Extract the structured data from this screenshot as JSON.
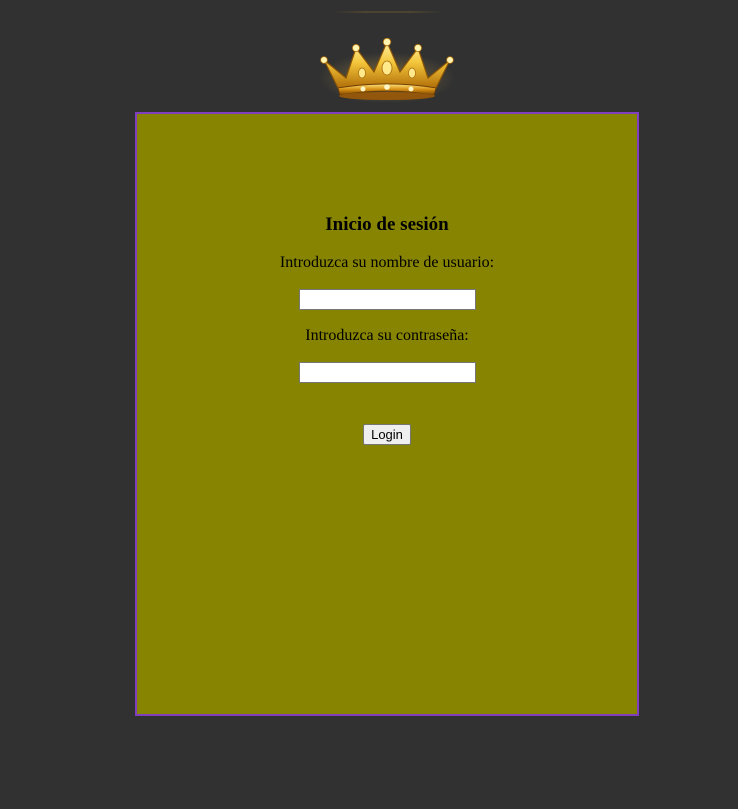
{
  "login": {
    "title": "Inicio de sesión",
    "username_label": "Introduzca su nombre de usuario:",
    "username_value": "",
    "password_label": "Introduzca su contraseña:",
    "password_value": "",
    "button_label": "Login"
  },
  "logo": {
    "icon": "crown-icon"
  },
  "colors": {
    "page_background": "#313131",
    "panel_background": "#868400",
    "panel_border": "#7f3fbf",
    "crown_gold": "#e8a91c"
  }
}
